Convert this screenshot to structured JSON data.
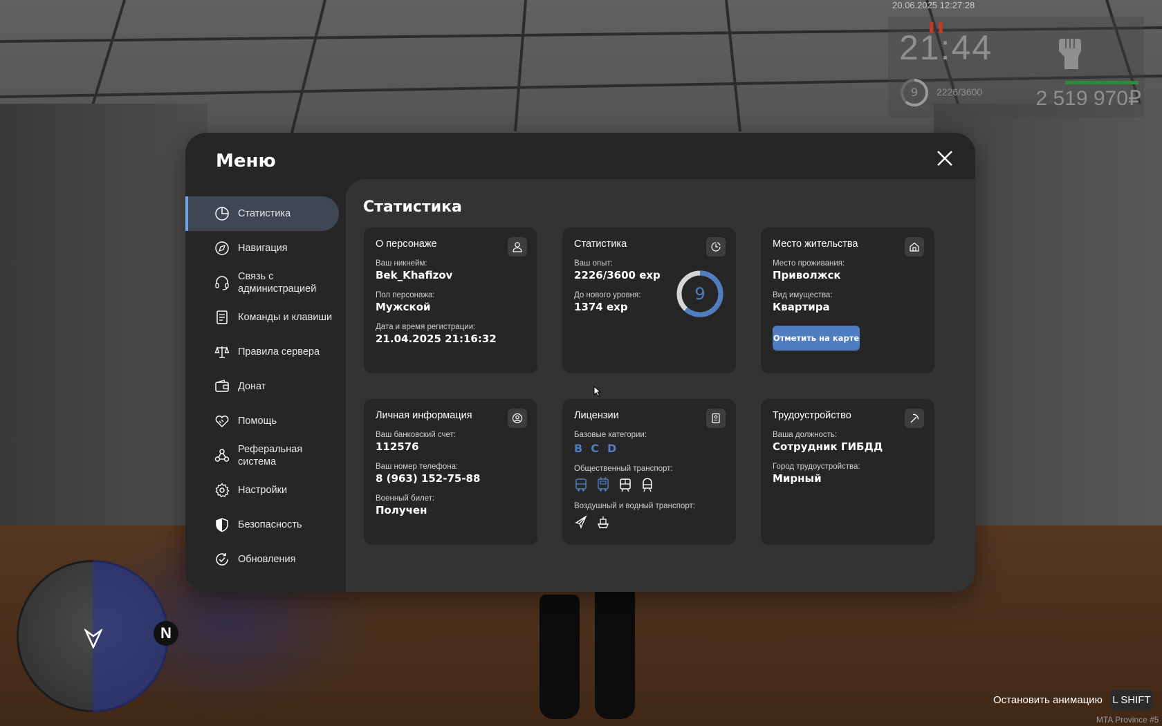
{
  "hud": {
    "datetime": "20.06.2025 12:27:28",
    "time": "21:44",
    "pause_icon": "pause-icon",
    "level": "9",
    "exp": "2226/3600",
    "money": "2 519 970₽",
    "health_color": "#2f8a3c",
    "stop_animation": "Остановить анимацию",
    "stop_animation_key": "L SHIFT",
    "server_name": "MTA Province #5",
    "radar_north": "N"
  },
  "menu": {
    "title": "Меню",
    "accent_color": "#4f7ec0",
    "nav": [
      {
        "label": "Статистика",
        "icon": "pie-chart-icon",
        "active": true
      },
      {
        "label": "Навигация",
        "icon": "compass-icon"
      },
      {
        "label": "Связь с администрацией",
        "icon": "headset-icon"
      },
      {
        "label": "Команды и клавиши",
        "icon": "document-icon"
      },
      {
        "label": "Правила сервера",
        "icon": "scales-icon"
      },
      {
        "label": "Донат",
        "icon": "wallet-icon"
      },
      {
        "label": "Помощь",
        "icon": "handshake-icon"
      },
      {
        "label": "Реферальная система",
        "icon": "network-icon"
      },
      {
        "label": "Настройки",
        "icon": "gear-icon"
      },
      {
        "label": "Безопасность",
        "icon": "shield-icon"
      },
      {
        "label": "Обновления",
        "icon": "refresh-check-icon"
      }
    ]
  },
  "content": {
    "title": "Статистика",
    "character": {
      "title": "О персонаже",
      "nickname_label": "Ваш никнейм:",
      "nickname": "Bek_Khafizov",
      "gender_label": "Пол персонажа:",
      "gender": "Мужской",
      "reg_label": "Дата и время регистрации:",
      "reg": "21.04.2025 21:16:32"
    },
    "stats": {
      "title": "Статистика",
      "exp_label": "Ваш опыт:",
      "exp": "2226/3600 exp",
      "next_label": "До нового уровня:",
      "next": "1374 exp",
      "level": "9",
      "progress": 0.618
    },
    "residence": {
      "title": "Место жительства",
      "place_label": "Место проживания:",
      "place": "Приволжск",
      "type_label": "Вид имущества:",
      "type": "Квартира",
      "button": "Отметить на карте"
    },
    "personal": {
      "title": "Личная информация",
      "bank_label": "Ваш банковский счет:",
      "bank": "112576",
      "phone_label": "Ваш номер телефона:",
      "phone": "8 (963) 152-75-88",
      "military_label": "Военный билет:",
      "military": "Получен"
    },
    "licenses": {
      "title": "Лицензии",
      "base_label": "Базовые категории:",
      "categories": [
        "B",
        "C",
        "D"
      ],
      "public_label": "Общественный транспорт:",
      "air_label": "Воздушный и водный транспорт:"
    },
    "job": {
      "title": "Трудоустройство",
      "position_label": "Ваша должность:",
      "position": "Сотрудник ГИБДД",
      "city_label": "Город трудоустройства:",
      "city": "Мирный"
    }
  }
}
